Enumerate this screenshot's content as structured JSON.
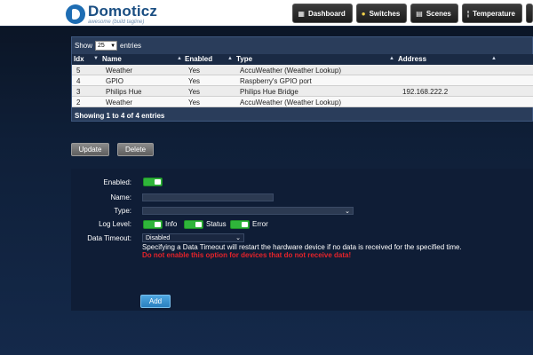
{
  "app": {
    "title": "Domoticz",
    "subtitle": "awesome (build tagline)"
  },
  "nav": [
    {
      "label": "Dashboard",
      "icon": "dashboard-icon"
    },
    {
      "label": "Switches",
      "icon": "lightbulb-icon"
    },
    {
      "label": "Scenes",
      "icon": "scenes-icon"
    },
    {
      "label": "Temperature",
      "icon": "thermometer-icon"
    }
  ],
  "table": {
    "show_label": "Show",
    "show_value": "25",
    "entries_label": "entries",
    "headers": [
      "Idx",
      "Name",
      "Enabled",
      "Type",
      "Address"
    ],
    "rows": [
      {
        "idx": "5",
        "name": "Weather",
        "enabled": "Yes",
        "type": "AccuWeather (Weather Lookup)",
        "address": ""
      },
      {
        "idx": "4",
        "name": "GPIO",
        "enabled": "Yes",
        "type": "Raspberry's GPIO port",
        "address": ""
      },
      {
        "idx": "3",
        "name": "Philips Hue",
        "enabled": "Yes",
        "type": "Philips Hue Bridge",
        "address": "192.168.222.2"
      },
      {
        "idx": "2",
        "name": "Weather",
        "enabled": "Yes",
        "type": "AccuWeather (Weather Lookup)",
        "address": ""
      }
    ],
    "info": "Showing 1 to 4 of 4 entries"
  },
  "actions": {
    "update": "Update",
    "delete": "Delete"
  },
  "form": {
    "enabled_label": "Enabled:",
    "name_label": "Name:",
    "name_value": "",
    "type_label": "Type:",
    "type_value": "",
    "loglevel_label": "Log Level:",
    "log_info": "Info",
    "log_status": "Status",
    "log_error": "Error",
    "timeout_label": "Data Timeout:",
    "timeout_value": "Disabled",
    "timeout_note": "Specifying a Data Timeout will restart the hardware device if no data is received for the specified time.",
    "timeout_warning": "Do not enable this option for devices that do not receive data!",
    "add": "Add"
  }
}
